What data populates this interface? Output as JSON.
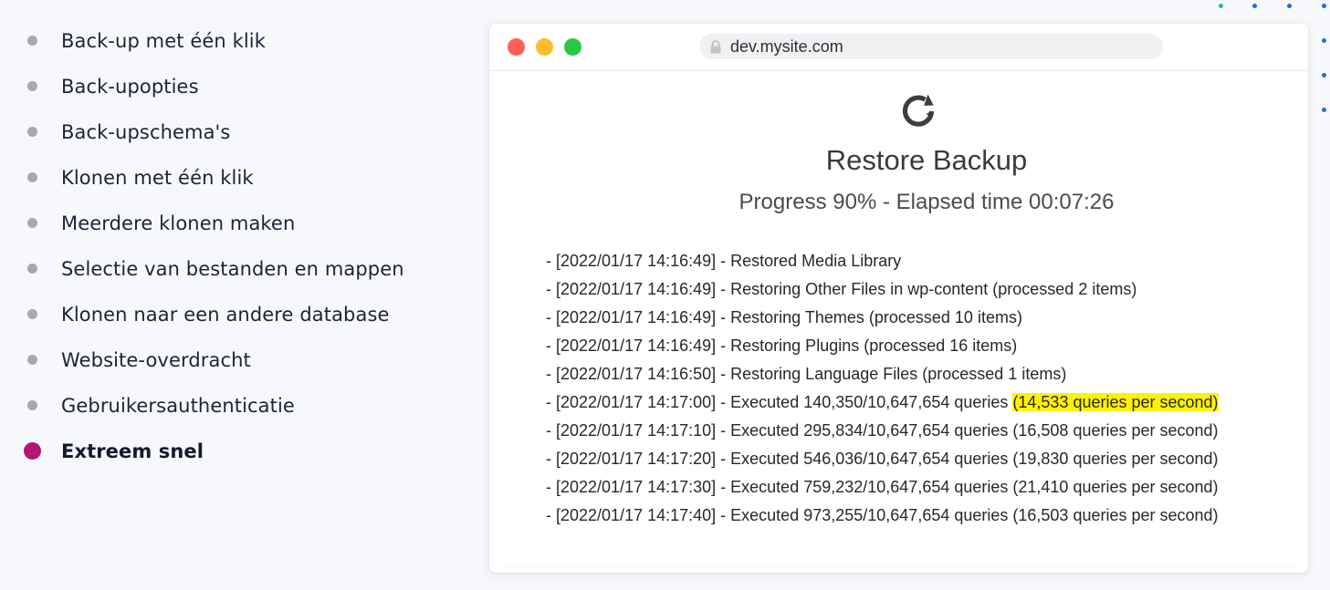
{
  "features": [
    {
      "label": "Back-up met één klik",
      "active": false
    },
    {
      "label": "Back-upopties",
      "active": false
    },
    {
      "label": "Back-upschema's",
      "active": false
    },
    {
      "label": "Klonen met één klik",
      "active": false
    },
    {
      "label": "Meerdere klonen maken",
      "active": false
    },
    {
      "label": "Selectie van bestanden en mappen",
      "active": false
    },
    {
      "label": "Klonen naar een andere database",
      "active": false
    },
    {
      "label": "Website-overdracht",
      "active": false
    },
    {
      "label": "Gebruikersauthenticatie",
      "active": false
    },
    {
      "label": "Extreem snel",
      "active": true
    }
  ],
  "browser": {
    "url": "dev.mysite.com",
    "lock_icon": "lock-icon"
  },
  "restore": {
    "icon": "refresh-icon",
    "title": "Restore Backup",
    "progress_text": "Progress 90% - Elapsed time 00:07:26",
    "progress_percent": 90,
    "elapsed_time": "00:07:26"
  },
  "log": [
    {
      "text": "- [2022/01/17 14:16:49] - Restored Media Library"
    },
    {
      "text": "- [2022/01/17 14:16:49] - Restoring Other Files in wp-content (processed 2 items)"
    },
    {
      "text": "- [2022/01/17 14:16:49] - Restoring Themes (processed 10 items)"
    },
    {
      "text": "- [2022/01/17 14:16:49] - Restoring Plugins (processed 16 items)"
    },
    {
      "text": "- [2022/01/17 14:16:50] - Restoring Language Files (processed 1 items)"
    },
    {
      "text": "- [2022/01/17 14:17:00] - Executed 140,350/10,647,654 queries ",
      "highlight": "(14,533 queries per second)"
    },
    {
      "text": "- [2022/01/17 14:17:10] - Executed 295,834/10,647,654 queries (16,508 queries per second)"
    },
    {
      "text": "- [2022/01/17 14:17:20] - Executed 546,036/10,647,654 queries (19,830 queries per second)"
    },
    {
      "text": "- [2022/01/17 14:17:30] - Executed 759,232/10,647,654 queries (21,410 queries per second)"
    },
    {
      "text": "- [2022/01/17 14:17:40] - Executed 973,255/10,647,654 queries (16,503 queries per second)"
    }
  ],
  "colors": {
    "active_bullet": "#b11773",
    "inactive_bullet": "#a7a9ae",
    "highlight": "#fff200",
    "traffic_close": "#fe5f57",
    "traffic_min": "#febc2e",
    "traffic_max": "#28c840",
    "deco_blue": "#1f6fdc",
    "deco_green": "#16c3a0"
  }
}
